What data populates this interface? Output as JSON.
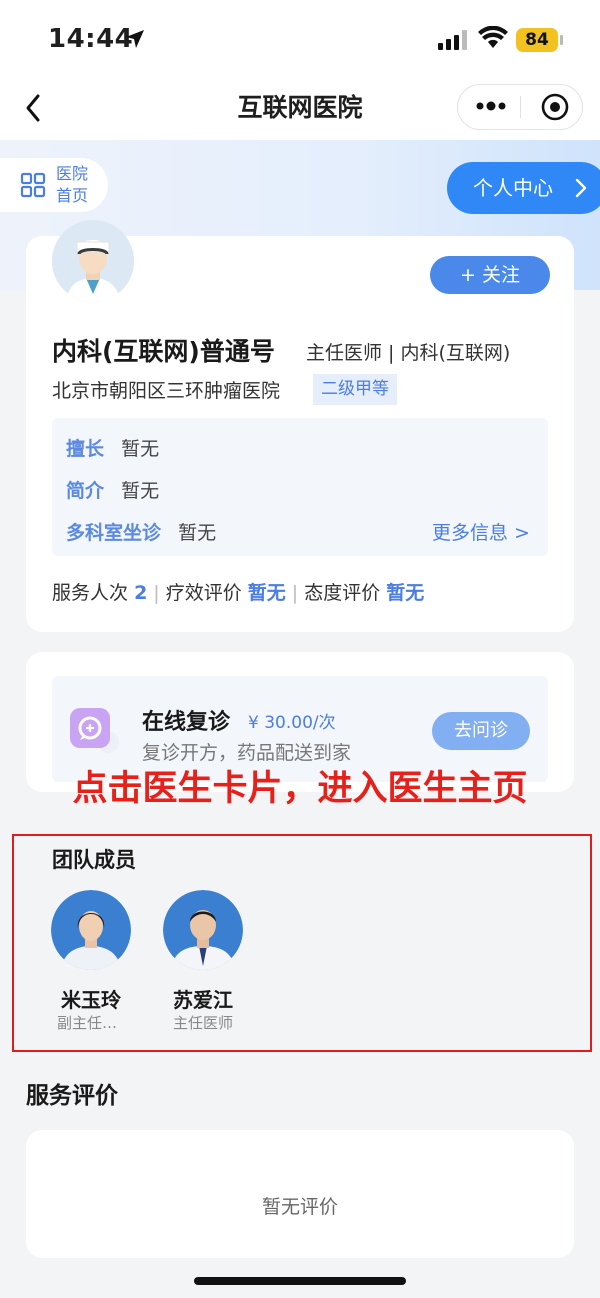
{
  "status_bar": {
    "time": "14:44",
    "battery": "84"
  },
  "nav": {
    "title": "互联网医院"
  },
  "header": {
    "home_label_1": "医院",
    "home_label_2": "首页",
    "personal_center": "个人中心"
  },
  "doctor": {
    "follow": "+ 关注",
    "name": "内科(互联网)普通号",
    "title": "主任医师 | 内科(互联网)",
    "hospital": "北京市朝阳区三环肿瘤医院",
    "level": "二级甲等",
    "info": [
      {
        "key": "擅长",
        "value": "暂无"
      },
      {
        "key": "简介",
        "value": "暂无"
      },
      {
        "key": "多科室坐诊",
        "value": "暂无"
      }
    ],
    "more_info": "更多信息 >",
    "stats": {
      "served_label": "服务人次",
      "served_value": "2",
      "efficacy_label": "疗效评价",
      "efficacy_value": "暂无",
      "attitude_label": "态度评价",
      "attitude_value": "暂无"
    }
  },
  "service": {
    "title": "在线复诊",
    "price": "¥ 30.00/次",
    "desc": "复诊开方，药品配送到家",
    "button": "去问诊"
  },
  "annotation": "点击医生卡片，进入医生主页",
  "team": {
    "title": "团队成员",
    "members": [
      {
        "name": "米玉玲",
        "role": "副主任…"
      },
      {
        "name": "苏爱江",
        "role": "主任医师"
      }
    ]
  },
  "reviews": {
    "title": "服务评价",
    "empty": "暂无评价"
  },
  "colors": {
    "accent": "#4a88ea",
    "annotation_red": "#e8201a",
    "brand_blue": "#2f88f5"
  }
}
